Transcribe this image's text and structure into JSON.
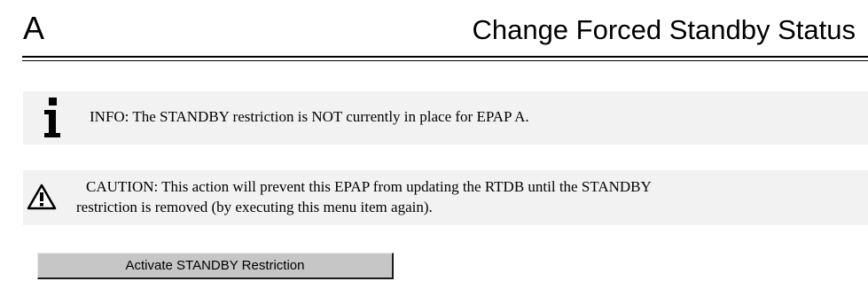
{
  "header": {
    "letter": "A",
    "title": "Change Forced Standby Status"
  },
  "info": {
    "icon": "info-icon",
    "text": "INFO: The STANDBY restriction is NOT currently in place for EPAP A."
  },
  "caution": {
    "icon": "warning-triangle-icon",
    "line1": "CAUTION: This action will prevent this EPAP from updating the RTDB until the STANDBY",
    "line2": "restriction is removed (by executing this menu item again)."
  },
  "actions": {
    "activate_label": "Activate STANDBY Restriction"
  }
}
